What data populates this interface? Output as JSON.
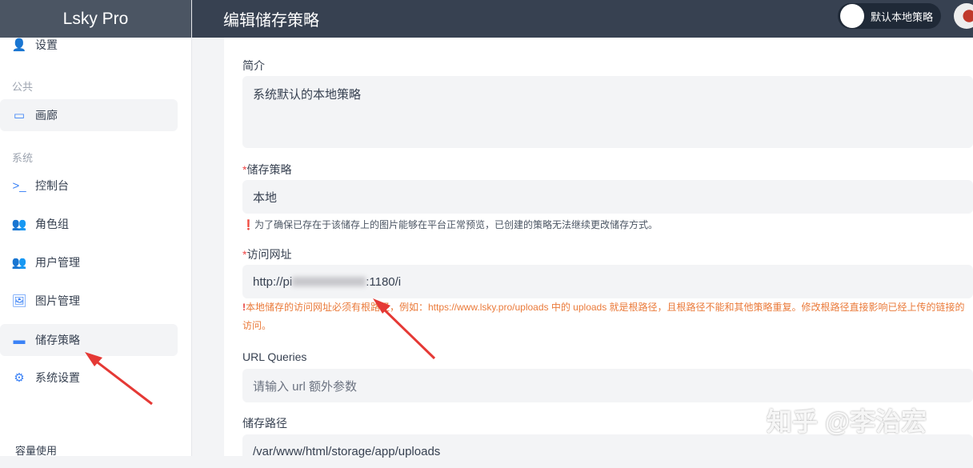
{
  "app": {
    "name": "Lsky Pro",
    "page_title": "编辑储存策略",
    "policy_button": "默认本地策略"
  },
  "sidebar": {
    "items": [
      {
        "label": "设置",
        "icon": "user-gear-icon"
      },
      {
        "label": "画廊",
        "icon": "laptop-icon"
      },
      {
        "label": "控制台",
        "icon": "terminal-icon"
      },
      {
        "label": "角色组",
        "icon": "users-icon"
      },
      {
        "label": "用户管理",
        "icon": "users-gear-icon"
      },
      {
        "label": "图片管理",
        "icon": "images-icon"
      },
      {
        "label": "储存策略",
        "icon": "hdd-icon"
      },
      {
        "label": "系统设置",
        "icon": "cogs-icon"
      }
    ],
    "groups": {
      "public": "公共",
      "system": "系统"
    },
    "usage": "容量使用"
  },
  "form": {
    "intro_label": "简介",
    "intro_value": "系统默认的本地策略",
    "storage_label": "储存策略",
    "storage_value": "本地",
    "storage_hint": "为了确保已存在于该储存上的图片能够在平台正常预览，已创建的策略无法继续更改储存方式。",
    "url_label": "访问网址",
    "url_prefix": "http://pi",
    "url_suffix": ":1180/i",
    "url_warning": "本地储存的访问网址必须有根路径，例如：https://www.lsky.pro/uploads 中的 uploads 就是根路径，且根路径不能和其他策略重复。修改根路径直接影响已经上传的链接的访问。",
    "queries_label": "URL Queries",
    "queries_placeholder": "请输入 url 额外参数",
    "path_label": "储存路径",
    "path_value": "/var/www/html/storage/app/uploads"
  },
  "watermark": "知乎 @李治宏",
  "colors": {
    "accent": "#3b82f6",
    "warning": "#ea7a3a",
    "annotation": "#e53935"
  }
}
